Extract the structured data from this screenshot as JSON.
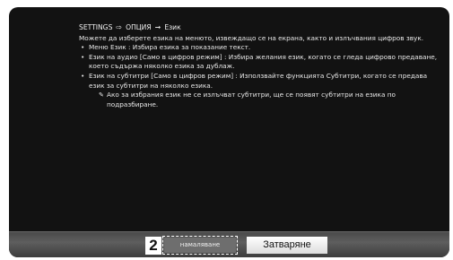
{
  "breadcrumb": {
    "settings": "SETTINGS",
    "option": "ОПЦИЯ",
    "language": "Език",
    "icon_settings_arrow": "hollow-right-arrow-icon",
    "icon_option_arrow": "right-arrow-icon"
  },
  "intro": "Можете да изберете езика на менюто, извеждащо се на екрана, както и излъчвания цифров звук.",
  "items": [
    {
      "label": "Меню Език : Избира езика за показание текст."
    },
    {
      "label": "Език на аудио [Само в цифров режим] : Избира желания език, когато се гледа цифрово предаване, което съдържа няколко езика за дублаж."
    },
    {
      "label": "Език на субтитри [Само в цифров режим] : Използвайте функцията Субтитри, когато се предава език за субтитри на няколко езика."
    }
  ],
  "note": {
    "icon": "note-icon",
    "text": "Ако за избрания език не се излъчват субтитри, ще се появят субтитри на езика по подразбиране."
  },
  "footer": {
    "callout_number": "2",
    "reduce_button": "намаляване",
    "close_button": "Затваряне"
  }
}
